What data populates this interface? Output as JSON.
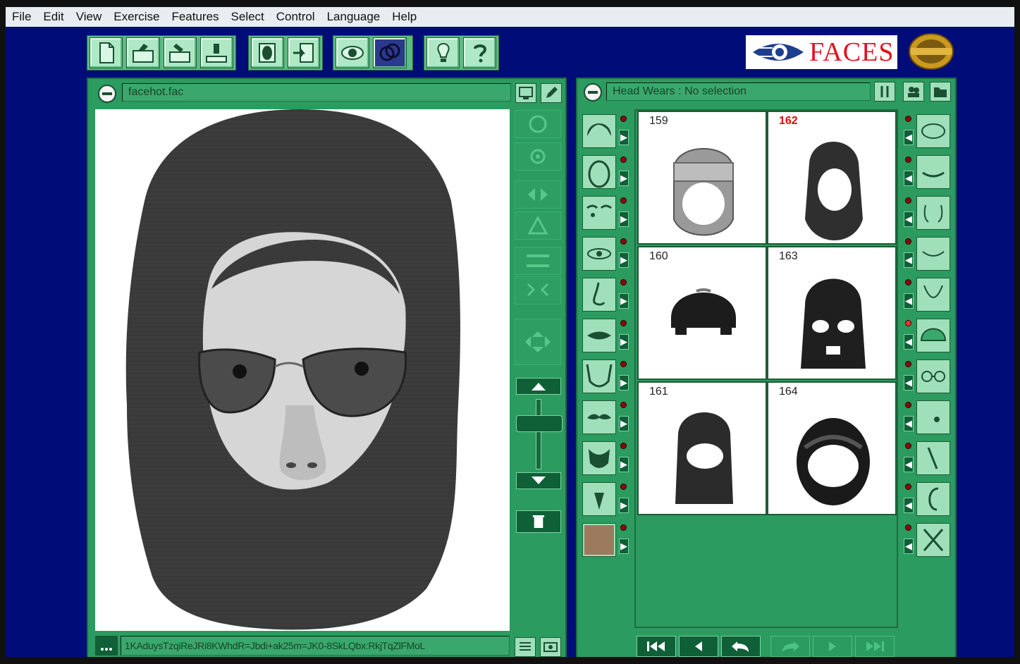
{
  "menu": [
    "File",
    "Edit",
    "View",
    "Exercise",
    "Features",
    "Select",
    "Control",
    "Language",
    "Help"
  ],
  "toolbar": {
    "group1": [
      "new-icon",
      "open-icon",
      "save-icon",
      "export-icon"
    ],
    "group2": [
      "face-icon",
      "import-icon"
    ],
    "group3": [
      "eye-icon",
      "overlay-icon"
    ],
    "group4": [
      "hint-bulb-icon",
      "help-icon"
    ]
  },
  "brand": {
    "name": "FACES"
  },
  "composite_panel": {
    "filename": "facehot.fac",
    "code": "1KAduysTzqiReJRi8KWhdR=Jbdi+ak25m=JK0-8SkLQbx:RkjTqZlFMoL"
  },
  "library_panel": {
    "title": "Head Wears : No selection",
    "items": [
      {
        "id": "159",
        "kind": "beanie",
        "selected": false
      },
      {
        "id": "162",
        "kind": "balaclava-open",
        "selected": true
      },
      {
        "id": "160",
        "kind": "helmet",
        "selected": false
      },
      {
        "id": "163",
        "kind": "mask",
        "selected": false
      },
      {
        "id": "161",
        "kind": "balaclava-round",
        "selected": false
      },
      {
        "id": "164",
        "kind": "motorcycle-helmet",
        "selected": false
      }
    ]
  },
  "feature_categories_left": [
    "hair",
    "head-shape",
    "eyebrows",
    "eyes",
    "nose",
    "lips",
    "jaw",
    "mustache",
    "beard",
    "goatee",
    "skin-tone"
  ],
  "feature_categories_right": [
    "cheeks",
    "mouth-lines",
    "nose-lines",
    "smile-lines",
    "chin",
    "head-wear",
    "glasses",
    "marks",
    "scars",
    "ears",
    "tools"
  ],
  "colors": {
    "background": "#000c78",
    "panel": "#2b9b5f",
    "accent_red": "#e00a0a"
  }
}
